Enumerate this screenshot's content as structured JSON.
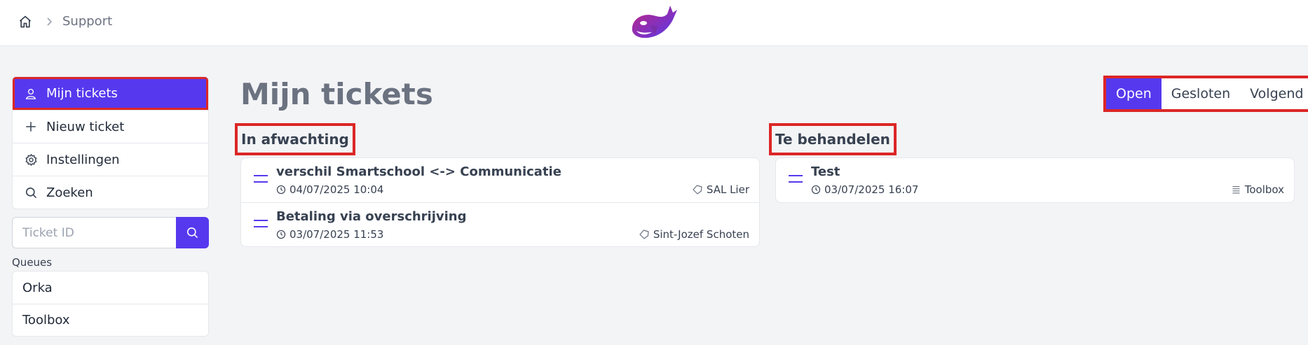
{
  "header": {
    "breadcrumb": [
      "Support"
    ],
    "home_icon": "home-icon",
    "logo": "orca-logo"
  },
  "sidebar": {
    "menu": [
      {
        "label": "Mijn tickets",
        "icon": "user-icon",
        "active": true
      },
      {
        "label": "Nieuw ticket",
        "icon": "plus-icon",
        "active": false
      },
      {
        "label": "Instellingen",
        "icon": "gear-icon",
        "active": false
      },
      {
        "label": "Zoeken",
        "icon": "search-icon",
        "active": false
      }
    ],
    "search": {
      "placeholder": "Ticket ID",
      "value": ""
    },
    "queues_label": "Queues",
    "queues": [
      "Orka",
      "Toolbox"
    ]
  },
  "main": {
    "title": "Mijn tickets",
    "filters": [
      {
        "label": "Open",
        "active": true
      },
      {
        "label": "Gesloten",
        "active": false
      },
      {
        "label": "Volgend",
        "active": false
      }
    ],
    "columns": [
      {
        "title": "In afwachting",
        "tickets": [
          {
            "title": "verschil Smartschool <-> Communicatie",
            "date": "04/07/2025 10:04",
            "tag": "SAL Lier",
            "tag_icon": "tag-icon"
          },
          {
            "title": "Betaling via overschrijving",
            "date": "03/07/2025 11:53",
            "tag": "Sint-Jozef Schoten",
            "tag_icon": "tag-icon"
          }
        ]
      },
      {
        "title": "Te behandelen",
        "tickets": [
          {
            "title": "Test",
            "date": "03/07/2025 16:07",
            "tag": "Toolbox",
            "tag_icon": "list-icon"
          }
        ]
      }
    ]
  },
  "colors": {
    "accent": "#5639ee",
    "highlight": "#dc2626",
    "background": "#f3f4f6"
  }
}
